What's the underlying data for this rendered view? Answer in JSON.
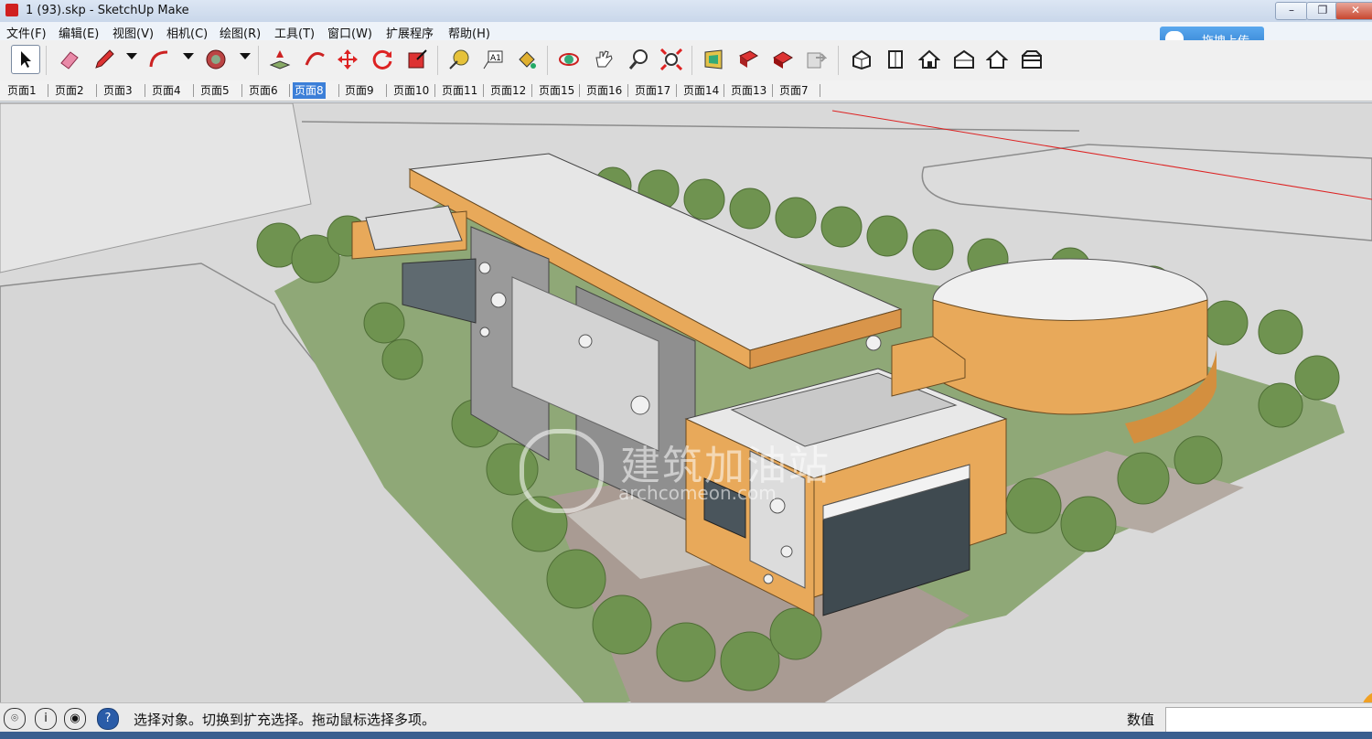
{
  "window": {
    "title": "1 (93).skp - SketchUp Make",
    "min_icon": "minimize-icon",
    "max_icon": "restore-icon",
    "close_icon": "close-icon"
  },
  "menu": {
    "items": [
      "文件(F)",
      "编辑(E)",
      "视图(V)",
      "相机(C)",
      "绘图(R)",
      "工具(T)",
      "窗口(W)",
      "扩展程序",
      "帮助(H)"
    ]
  },
  "upload": {
    "label": "拖拽上传",
    "icon": "cloud-upload-icon"
  },
  "toolbar": {
    "icons": [
      "select-icon",
      "eraser-icon",
      "pencil-icon",
      "arc-icon",
      "shape-icon",
      "push-pull-icon",
      "follow-me-icon",
      "move-icon",
      "rotate-icon",
      "scale-icon",
      "tape-measure-icon",
      "text-icon",
      "paint-bucket-icon",
      "orbit-icon",
      "pan-icon",
      "zoom-icon",
      "zoom-extents-icon",
      "3d-warehouse-icon",
      "share-model-icon",
      "extension-warehouse-icon",
      "send-to-layout-icon",
      "iso-view-icon",
      "top-view-icon",
      "front-view-icon",
      "right-view-icon",
      "back-view-icon",
      "left-view-icon"
    ]
  },
  "scenes": {
    "tabs": [
      "页面1",
      "页面2",
      "页面3",
      "页面4",
      "页面5",
      "页面6",
      "页面8",
      "页面9",
      "页面10",
      "页面11",
      "页面12",
      "页面15",
      "页面16",
      "页面17",
      "页面14",
      "页面13",
      "页面7"
    ],
    "active": "页面8"
  },
  "watermark": {
    "text": "建筑加油站",
    "url": "archcomeon.com"
  },
  "status": {
    "message": "选择对象。切换到扩充选择。拖动鼠标选择多项。",
    "measurements_label": "数值",
    "measurements_value": ""
  },
  "colors": {
    "accent": "#3c7fd8",
    "facade": "#e8a95a",
    "ground": "#8fa877"
  }
}
